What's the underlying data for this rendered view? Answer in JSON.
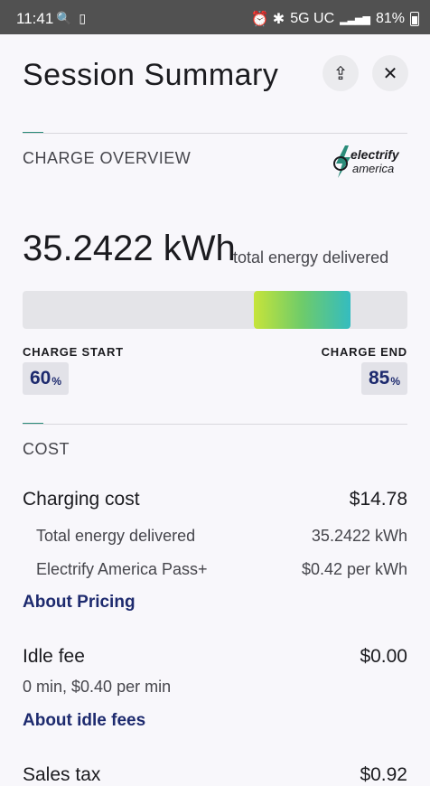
{
  "status_bar": {
    "time": "11:41",
    "left_icons": "🔍 ▯",
    "right_icons": "⏰ ✱",
    "network": "5G UC",
    "signal": "▂▃▅▆",
    "battery": "81%"
  },
  "header": {
    "title": "Session Summary",
    "share_icon": "share-icon",
    "close_icon": "close-icon",
    "share_glyph": "⇪",
    "close_glyph": "✕"
  },
  "charge_overview": {
    "section_title": "CHARGE OVERVIEW",
    "logo_text_1": "electrify",
    "logo_text_2": "america",
    "energy_value": "35.2422 kWh",
    "energy_label": "total energy delivered",
    "start_label": "CHARGE START",
    "end_label": "CHARGE END",
    "start_pct": "60",
    "end_pct": "85",
    "pct_unit": "%",
    "bar_start_fraction": 0.6,
    "bar_end_fraction": 0.85
  },
  "cost": {
    "section_title": "COST",
    "charging_cost_label": "Charging cost",
    "charging_cost_value": "$14.78",
    "energy_sub_label": "Total energy delivered",
    "energy_sub_value": "35.2422 kWh",
    "pass_label": "Electrify America Pass+",
    "pass_value": "$0.42 per kWh",
    "about_pricing": "About Pricing",
    "idle_fee_label": "Idle fee",
    "idle_fee_value": "$0.00",
    "idle_note": "0 min, $0.40 per min",
    "about_idle": "About idle fees",
    "sales_tax_label": "Sales tax",
    "sales_tax_value": "$0.92"
  },
  "colors": {
    "accent": "#2b8c7a",
    "link": "#1d2a6e",
    "bar_gradient_start": "#c6e43a",
    "bar_gradient_end": "#34bcc0"
  }
}
